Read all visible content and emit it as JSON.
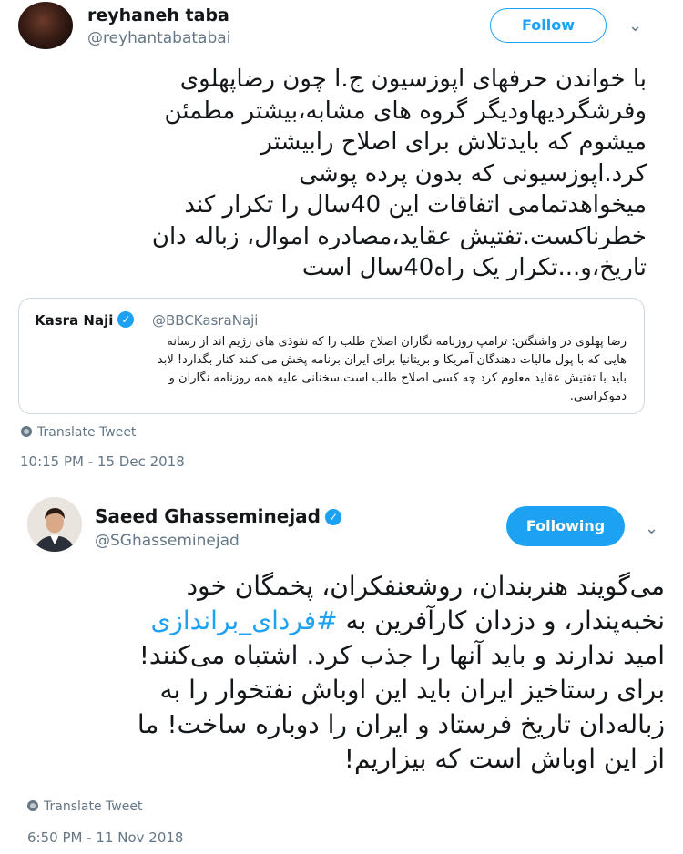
{
  "tweet1": {
    "name": "reyhaneh taba",
    "handle": "@reyhantabatabai",
    "follow_label": "Follow",
    "text_lines": [
      "با خواندن حرفهای اپوزسیون ج.ا چون رضاپهلوی",
      "وفرشگردیهاودیگر گروه های مشابه،بیشتر مطمئن",
      "میشوم که بایدتلاش برای اصلاح رابیشتر",
      "کرد.اپوزسیونی که بدون پرده پوشی",
      "میخواهدتمامی اتفاقات این 40سال را تکرار کند",
      "خطرناکست.تفتیش عقاید،مصادره اموال، زباله دان",
      "تاریخ،و...تکرار یک راه40سال است"
    ],
    "quote": {
      "name": "Kasra Naji",
      "handle": "@BBCKasraNaji",
      "lines": [
        "رضا پهلوی در واشنگتن: ترامپ روزنامه نگاران اصلاح طلب را که نفوذی های رژیم اند از رسانه",
        "هایی که با پول مالیات دهندگان آمریکا و بریتانیا برای ایران برنامه پخش می کنند کنار بگذارد! لابد",
        "باید با تفتیش عقاید معلوم کرد چه کسی اصلاح طلب است.سخنانی علیه همه روزنامه نگاران و",
        "دموکراسی."
      ]
    },
    "translate_label": "Translate Tweet",
    "timestamp": "10:15 PM - 15 Dec 2018"
  },
  "tweet2": {
    "name": "Saeed Ghasseminejad",
    "handle": "@SGhasseminejad",
    "following_label": "Following",
    "line1": "می‌گویند هنربندان، روشعنفکران، پخمگان خود",
    "line2_prefix": "نخبه‌پندار، و دزدان کارآفرین به ",
    "hashtag": "#فردای_براندازی",
    "text_lines_rest": [
      "امید ندارند و باید آنها را جذب کرد. اشتباه می‌کنند!",
      "برای رستاخیز ایران باید این اوباش نفتخوار را به",
      "زباله‌دان تاریخ فرستاد و ایران را دوباره ساخت! ما",
      "از این اوباش است که بیزاریم!"
    ],
    "translate_label": "Translate Tweet",
    "timestamp": "6:50 PM - 11 Nov 2018"
  },
  "colors": {
    "accent": "#1da1f2",
    "secondary_text": "#657786",
    "border": "#ccd6dd"
  },
  "icons": [
    "avatar",
    "verified-badge-icon",
    "chevron-down-icon",
    "globe-icon"
  ]
}
